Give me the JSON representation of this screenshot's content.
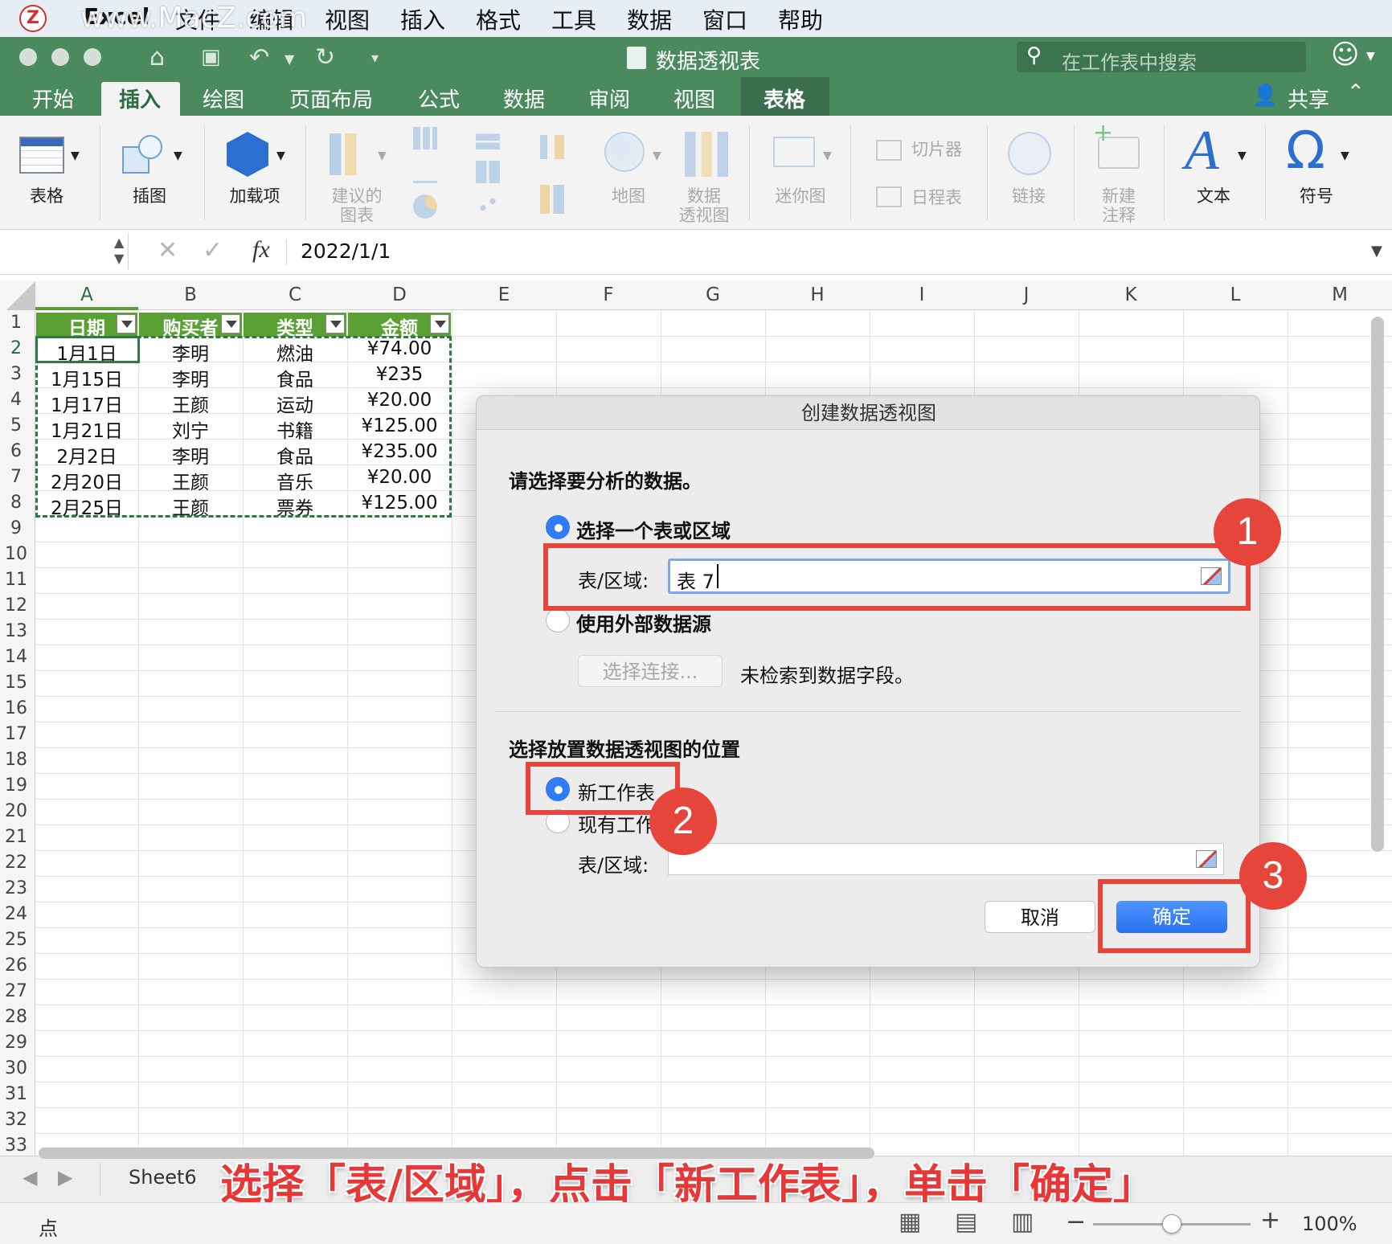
{
  "menubar": {
    "app_name": "Excel",
    "watermark": "www.MacZ.com",
    "items": [
      "文件",
      "编辑",
      "视图",
      "插入",
      "格式",
      "工具",
      "数据",
      "窗口",
      "帮助"
    ]
  },
  "titlebar": {
    "doc_title": "数据透视表",
    "search_placeholder": "在工作表中搜索"
  },
  "tabs": [
    "开始",
    "插入",
    "绘图",
    "页面布局",
    "公式",
    "数据",
    "审阅",
    "视图",
    "表格"
  ],
  "share_label": "共享",
  "ribbon": {
    "table": "表格",
    "illustrations": "插图",
    "addins": "加载项",
    "recommended_charts_1": "建议的",
    "recommended_charts_2": "图表",
    "map": "地图",
    "pivotchart_1": "数据",
    "pivotchart_2": "透视图",
    "sparkline": "迷你图",
    "slicer": "切片器",
    "timeline": "日程表",
    "link": "链接",
    "new_comment_1": "新建",
    "new_comment_2": "注释",
    "text": "文本",
    "symbol": "符号"
  },
  "formula": {
    "fx": "fx",
    "value": "2022/1/1"
  },
  "columns": [
    "A",
    "B",
    "C",
    "D",
    "E",
    "F",
    "G",
    "H",
    "I",
    "J",
    "K",
    "L",
    "M"
  ],
  "rows": [
    "1",
    "2",
    "3",
    "4",
    "5",
    "6",
    "7",
    "8",
    "9",
    "10",
    "11",
    "12",
    "13",
    "14",
    "15",
    "16",
    "17",
    "18",
    "19",
    "20",
    "21",
    "22",
    "23",
    "24",
    "25",
    "26",
    "27",
    "28",
    "29",
    "30",
    "31",
    "32",
    "33"
  ],
  "table": {
    "headers": [
      "日期",
      "购买者",
      "类型",
      "金额"
    ],
    "rows": [
      [
        "1月1日",
        "李明",
        "燃油",
        "¥74.00"
      ],
      [
        "1月15日",
        "李明",
        "食品",
        "¥235"
      ],
      [
        "1月17日",
        "王颜",
        "运动",
        "¥20.00"
      ],
      [
        "1月21日",
        "刘宁",
        "书籍",
        "¥125.00"
      ],
      [
        "2月2日",
        "李明",
        "食品",
        "¥235.00"
      ],
      [
        "2月20日",
        "王颜",
        "音乐",
        "¥20.00"
      ],
      [
        "2月25日",
        "王颜",
        "票券",
        "¥125.00"
      ]
    ]
  },
  "dialog": {
    "title": "创建数据透视图",
    "section1": "请选择要分析的数据。",
    "opt_select_table": "选择一个表或区域",
    "range_label": "表/区域:",
    "range_value": "表 7",
    "opt_external": "使用外部数据源",
    "choose_connection": "选择连接...",
    "no_fields": "未检索到数据字段。",
    "section2": "选择放置数据透视图的位置",
    "opt_new_sheet": "新工作表",
    "opt_existing_sheet": "现有工作表",
    "range_label2": "表/区域:",
    "cancel": "取消",
    "ok": "确定"
  },
  "annotations": {
    "badge1": "1",
    "badge2": "2",
    "badge3": "3",
    "caption": "选择「表/区域」，点击「新工作表」，单击「确定」"
  },
  "sheet_tab": "Sheet6",
  "status": {
    "mode": "点",
    "zoom": "100%",
    "zoom_fraction": 0.5
  },
  "colors": {
    "excel_green": "#4a8a5e",
    "table_header_green": "#5aa033",
    "annotation_red": "#e5453b",
    "ok_blue": "#2f7cf6"
  }
}
